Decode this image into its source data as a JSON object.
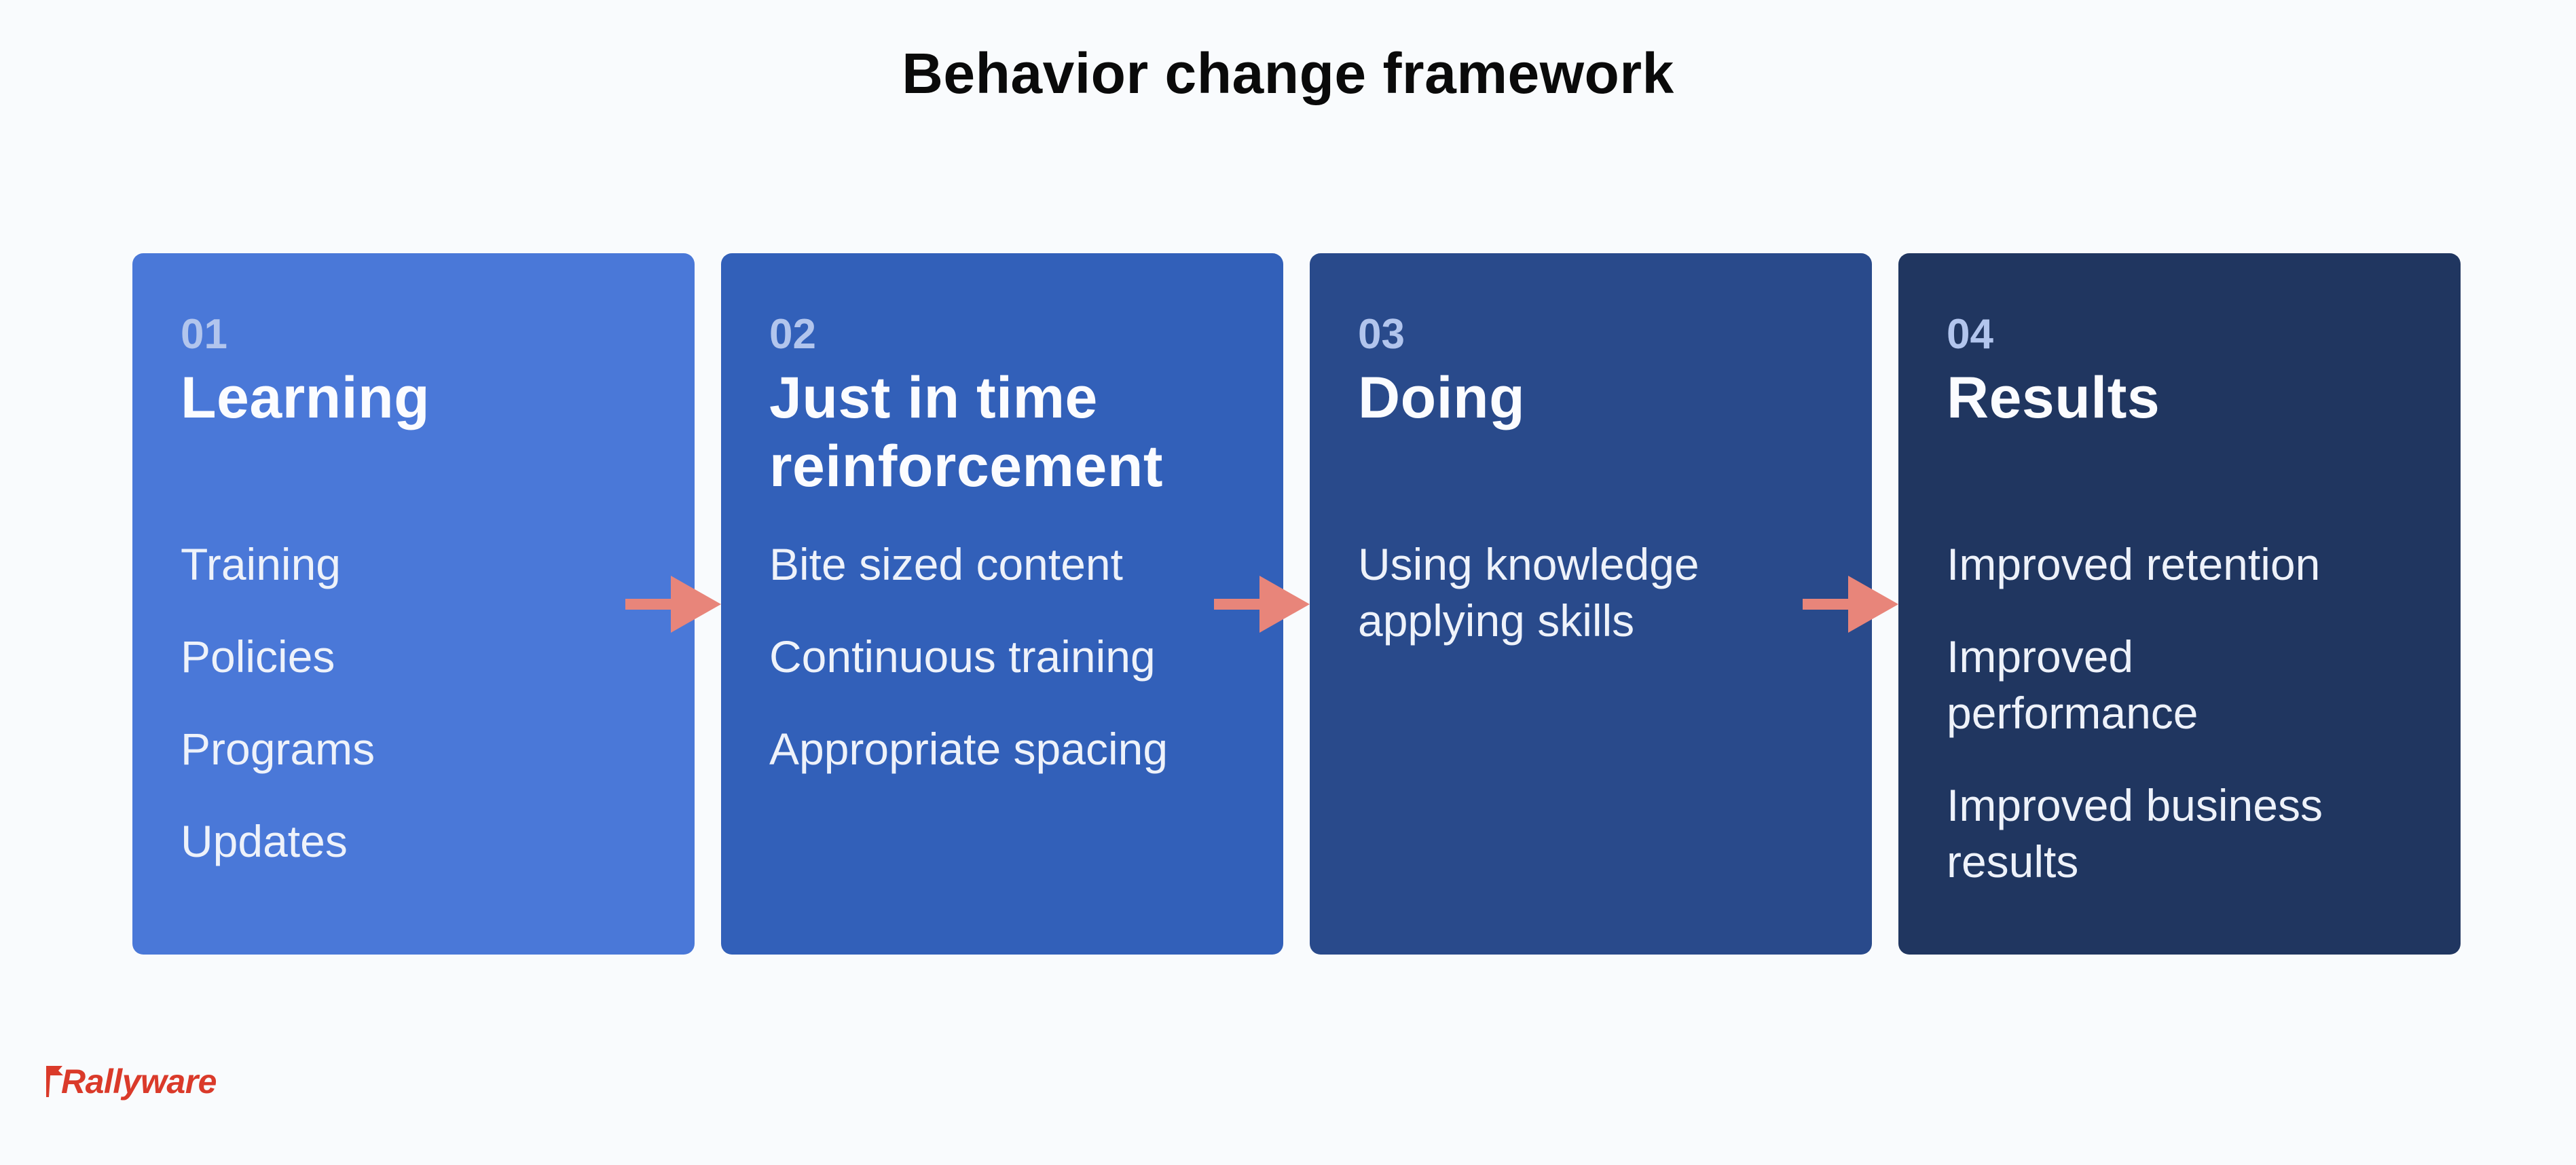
{
  "title": "Behavior change framework",
  "colors": {
    "background": "#f9fbfd",
    "arrow": "#e8857a",
    "step_number": "#b2c5ed",
    "heading_text": "#fbfcff",
    "item_text": "#eef2fa",
    "logo": "#da3a2a"
  },
  "steps": [
    {
      "number": "01",
      "heading": "Learning",
      "color": "#4a78d8",
      "items": [
        "Training",
        "Policies",
        "Programs",
        "Updates"
      ]
    },
    {
      "number": "02",
      "heading": "Just in time\nreinforcement",
      "color": "#3260b9",
      "items": [
        "Bite sized content",
        "Continuous training",
        "Appropriate spacing"
      ]
    },
    {
      "number": "03",
      "heading": "Doing",
      "color": "#294a8b",
      "items": [
        "Using knowledge\napplying skills"
      ]
    },
    {
      "number": "04",
      "heading": "Results",
      "color": "#203660",
      "items": [
        "Improved retention",
        "Improved\nperformance",
        "Improved business\nresults"
      ]
    }
  ],
  "arrows": [
    {
      "from": "01",
      "to": "02",
      "icon": "arrow-right-icon"
    },
    {
      "from": "02",
      "to": "03",
      "icon": "arrow-right-icon"
    },
    {
      "from": "03",
      "to": "04",
      "icon": "arrow-right-icon"
    }
  ],
  "logo": {
    "text": "Rallyware",
    "icon": "flag-icon"
  }
}
